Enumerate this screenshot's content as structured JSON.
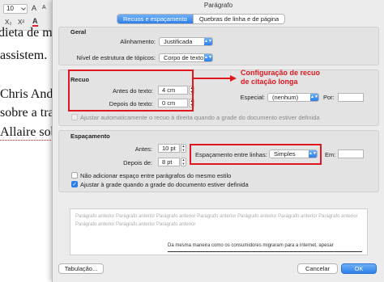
{
  "document": {
    "toolbar": {
      "font_size": "10",
      "grow_font": "A",
      "shrink_font": "A",
      "subscript": "X₂",
      "superscript": "X²",
      "font_color": "A"
    },
    "lines": [
      "dieta de m",
      "assistem.",
      "Chris Ande",
      "sobre a tra",
      "Allaire sob"
    ]
  },
  "dialog": {
    "title": "Parágrafo",
    "tabs": [
      {
        "label": "Recuos e espaçamento",
        "active": true
      },
      {
        "label": "Quebras de linha e de página",
        "active": false
      }
    ],
    "geral": {
      "title": "Geral",
      "alignment_label": "Alinhamento:",
      "alignment_value": "Justificada",
      "outline_label": "Nível de estrutura de tópicos:",
      "outline_value": "Corpo de texto"
    },
    "recuo": {
      "title": "Recuo",
      "before_label": "Antes do texto:",
      "before_value": "4 cm",
      "after_label": "Depois do texto:",
      "after_value": "0 cm",
      "special_label": "Especial:",
      "special_value": "(nenhum)",
      "by_label": "Por:",
      "by_value": "",
      "auto_adjust_label": "Ajustar automaticamente o recuo à direita quando a grade do documento estiver definida",
      "auto_adjust_checked": false
    },
    "espacamento": {
      "title": "Espaçamento",
      "before_label": "Antes:",
      "before_value": "10 pt",
      "after_label": "Depois de:",
      "after_value": "8 pt",
      "line_spacing_label": "Espaçamento entre linhas:",
      "line_spacing_value": "Simples",
      "em_label": "Em:",
      "em_value": "",
      "no_space_label": "Não adicionar espaço entre parágrafos do mesmo estilo",
      "no_space_checked": false,
      "snap_grid_label": "Ajustar à grade quando a grade do documento estiver definida",
      "snap_grid_checked": true
    },
    "preview": {
      "previous_text": "Parágrafo anterior Parágrafo anterior Parágrafo anterior Parágrafo anterior Parágrafo anterior Parágrafo anterior Parágrafo anterior Parágrafo anterior Parágrafo anterior Parágrafo anterior",
      "current_text": "Da mesma maneira como os consumidores migraram para a internet, apesar"
    },
    "buttons": {
      "tabs_label": "Tabulação...",
      "cancel_label": "Cancelar",
      "ok_label": "OK"
    }
  },
  "annotation": {
    "text_line1": "Configuração de recuo",
    "text_line2": "de citação longa",
    "color": "#e0171f"
  },
  "colors": {
    "accent": "#2d7fe8",
    "annotation": "#e0171f",
    "dialog_bg": "#ececec"
  }
}
